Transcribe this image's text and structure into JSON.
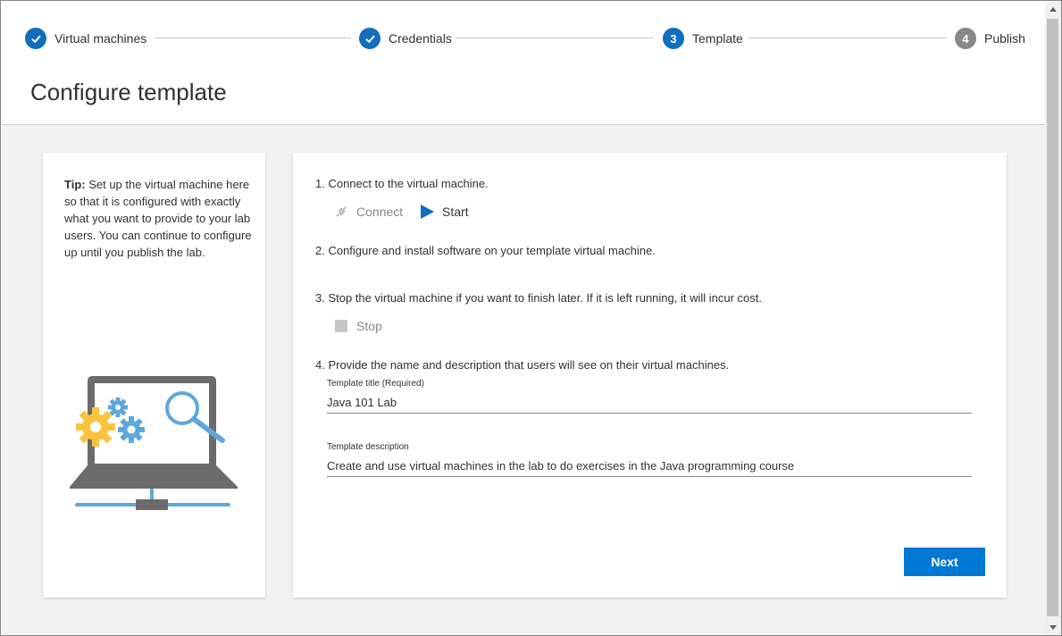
{
  "stepper": {
    "steps": [
      {
        "label": "Virtual machines",
        "status": "done"
      },
      {
        "label": "Credentials",
        "status": "done"
      },
      {
        "label": "Template",
        "number": "3",
        "status": "active"
      },
      {
        "label": "Publish",
        "number": "4",
        "status": "todo"
      }
    ]
  },
  "page": {
    "title": "Configure template"
  },
  "tip": {
    "bold": "Tip:",
    "text": " Set up the virtual machine here so that it is configured with exactly what you want to provide to your lab users. You can continue to configure up until you publish the lab."
  },
  "instructions": {
    "step1": "1. Connect to the virtual machine.",
    "connect_label": "Connect",
    "start_label": "Start",
    "step2": "2. Configure and install software on your template virtual machine.",
    "step3": "3. Stop the virtual machine if you want to finish later. If it is left running, it will incur cost.",
    "stop_label": "Stop",
    "step4": "4. Provide the name and description that users will see on their virtual machines."
  },
  "form": {
    "title_label": "Template title (Required)",
    "title_value": "Java 101 Lab",
    "description_label": "Template description",
    "description_value": "Create and use virtual machines in the lab to do exercises in the Java programming course"
  },
  "buttons": {
    "next": "Next"
  },
  "colors": {
    "accent": "#0078d4",
    "step_active": "#106ebe",
    "step_todo": "#8a8886",
    "gear_yellow": "#f8c43e",
    "gear_blue": "#5ea7dc",
    "laptop_gray": "#6b6b6b"
  },
  "icons": {
    "check": "checkmark-icon",
    "connect": "plug-icon",
    "start": "play-icon",
    "stop": "stop-icon"
  }
}
